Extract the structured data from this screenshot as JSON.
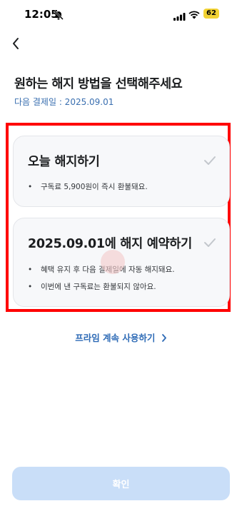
{
  "status_bar": {
    "time": "12:05",
    "battery": "62"
  },
  "header": {
    "title": "원하는 해지 방법을 선택해주세요",
    "next_payment": "다음 결제일 : 2025.09.01"
  },
  "options": [
    {
      "title": "오늘 해지하기",
      "bullets": [
        "구독료 5,900원이 즉시 환불돼요."
      ]
    },
    {
      "title": "2025.09.01에 해지 예약하기",
      "bullets": [
        "혜택 유지 후 다음 결제일에 자동 해지돼요.",
        "이번에 낸 구독료는 환불되지 않아요."
      ]
    }
  ],
  "continue_link": "프라임 계속 사용하기",
  "confirm_button": "확인",
  "colors": {
    "accent": "#2e6bb6",
    "confirm_disabled": "#c9def8",
    "highlight": "#ff0000",
    "battery": "#f2d233"
  }
}
